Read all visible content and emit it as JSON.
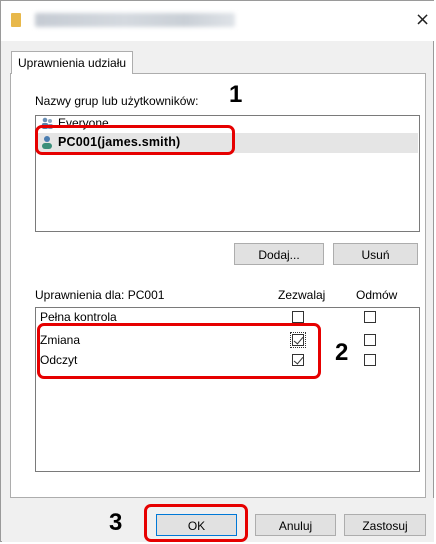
{
  "dialog": {
    "close_glyph": "×"
  },
  "tab": {
    "label": "Uprawnienia udziału"
  },
  "groups": {
    "heading": "Nazwy grup lub użytkowników:",
    "items": [
      {
        "name": "Everyone",
        "icon": "group-users-icon"
      },
      {
        "name": "PC001(james.smith)",
        "icon": "user-icon",
        "selected": true
      }
    ],
    "add_button": "Dodaj...",
    "remove_button": "Usuń"
  },
  "permissions": {
    "heading": "Uprawnienia dla: PC001",
    "allow_header": "Zezwalaj",
    "deny_header": "Odmów",
    "rows": [
      {
        "label": "Pełna kontrola",
        "allow": false,
        "deny": false
      },
      {
        "label": "Zmiana",
        "allow": true,
        "deny": false
      },
      {
        "label": "Odczyt",
        "allow": true,
        "deny": false
      }
    ]
  },
  "footer": {
    "ok_button": "OK",
    "cancel_button": "Anuluj",
    "apply_button": "Zastosuj"
  },
  "callouts": [
    "1",
    "2",
    "3"
  ],
  "colors": {
    "highlight": "#e60000",
    "accent_focus": "#0078d7"
  }
}
